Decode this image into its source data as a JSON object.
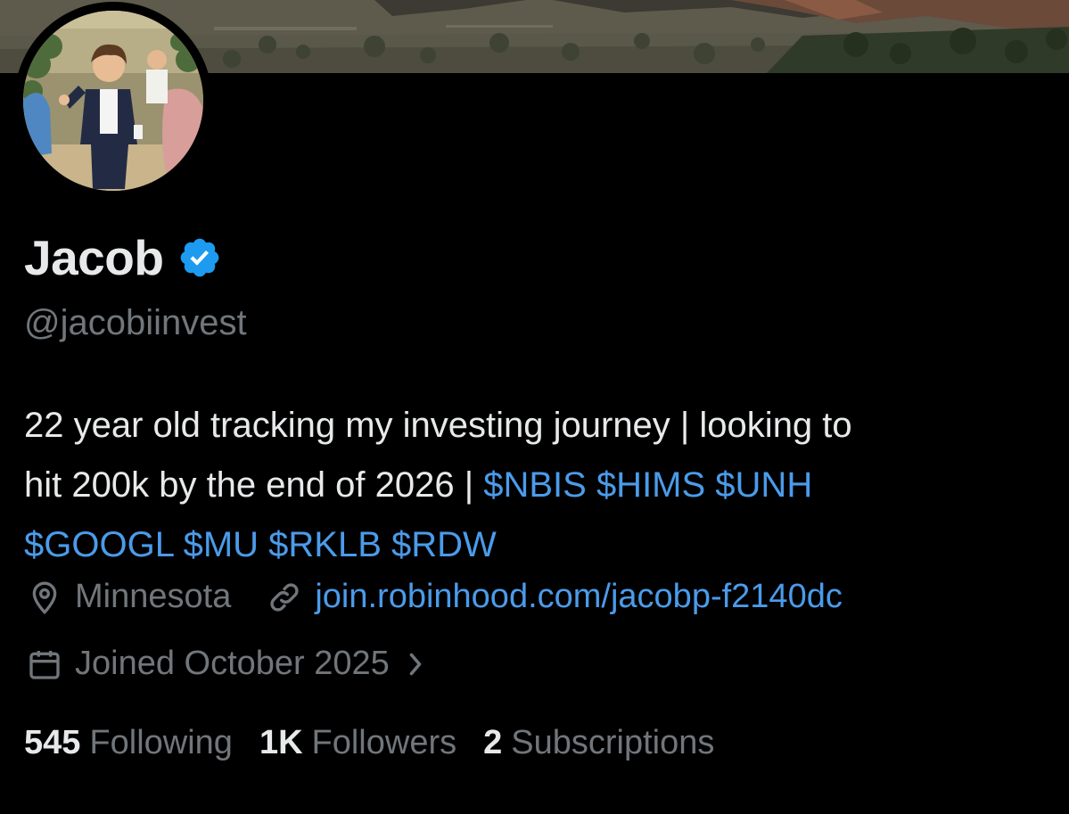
{
  "profile": {
    "display_name": "Jacob",
    "handle": "@jacobiinvest",
    "verified_icon": "verified-badge-icon",
    "bio": {
      "line1": "22 year old tracking my investing journey | looking to",
      "line2_text": "hit 200k by the end of 2026 | ",
      "line2_tags": "$NBIS $HIMS $UNH",
      "line3_tags": "$GOOGL $MU $RKLB $RDW"
    },
    "location": "Minnesota",
    "website": "join.robinhood.com/jacobp-f2140dc",
    "joined": "Joined October 2025",
    "stats": [
      {
        "value": "545",
        "label": "Following"
      },
      {
        "value": "1K",
        "label": "Followers"
      },
      {
        "value": "2",
        "label": "Subscriptions"
      }
    ]
  },
  "icons": {
    "location": "location-pin-icon",
    "link": "link-icon",
    "calendar": "calendar-icon",
    "chevron": "chevron-right-icon"
  },
  "colors": {
    "background": "#000000",
    "text_primary": "#e7e9ea",
    "text_secondary": "#71767b",
    "accent": "#4b9bea",
    "verified": "#1d9bf0"
  }
}
